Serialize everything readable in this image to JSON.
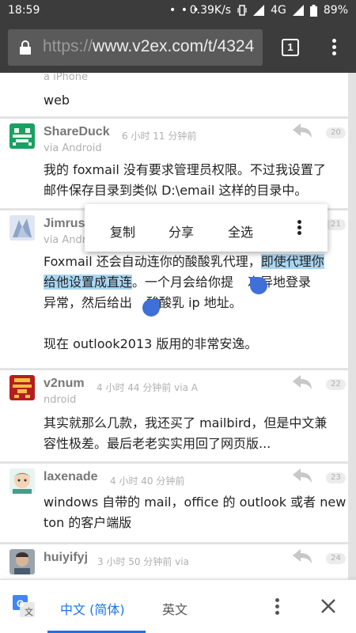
{
  "status": {
    "time": "18:59",
    "speed": "0.39K/s",
    "network": "4G",
    "battery": "89%"
  },
  "browser": {
    "url_scheme": "https://",
    "url_rest": "www.v2ex.com/t/4324",
    "tab_count": "1"
  },
  "partial_top": {
    "via": "a iPhone",
    "body": "web"
  },
  "comments": [
    {
      "user": "ShareDuck",
      "time": "6 小时 11 分钟前",
      "via": "via Android",
      "floor": "20",
      "body1": "我的 foxmail 没有要求管理员权限。不过我设置了",
      "body2": "邮件保存目录到类似 D:\\email 这样的目录中。"
    },
    {
      "user": "Jimrus",
      "via": "via Andr",
      "floor": "21",
      "line1_plain": "Foxmail 还会自动连你的酸酸乳代理，",
      "line1_sel": "即使代理你",
      "line2_sel": "给他设置成直连",
      "line2_plain": "。一个月会给你提",
      "line2_tail": "次异地登录",
      "line3_a": "异常，然后给出",
      "line3_b": "酸酸乳 ip 地址。",
      "line4": "现在 outlook2013 版用的非常安逸。"
    },
    {
      "user": "v2num",
      "time": "4 小时 44 分钟前 via A",
      "via": "ndroid",
      "floor": "22",
      "body1": "其实就那么几款，我还买了 mailbird，但是中文兼",
      "body2": "容性极差。最后老老实实用回了网页版..."
    },
    {
      "user": "laxenade",
      "time": "4 小时 40 分钟前",
      "floor": "23",
      "body1": "windows 自带的 mail，office 的 outlook 或者 new",
      "body2": "ton 的客户端版"
    },
    {
      "user": "huiyifyj",
      "time": "3 小时 50 分钟前 via",
      "floor": "24"
    }
  ],
  "popup": {
    "copy": "复制",
    "share": "分享",
    "select_all": "全选"
  },
  "translate": {
    "source_lang": "中文 (简体)",
    "target_lang": "英文"
  },
  "colors": {
    "accent": "#1a73e8",
    "selection": "#a9d6f2",
    "handle": "#3f6fd8",
    "toolbar": "#3c3c3c"
  }
}
